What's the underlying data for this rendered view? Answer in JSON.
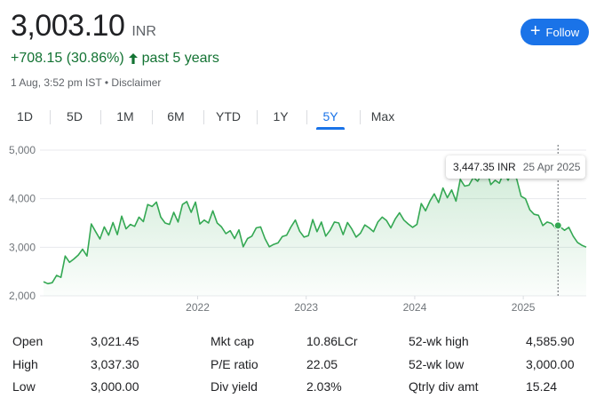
{
  "header": {
    "price": "3,003.10",
    "currency": "INR",
    "follow_label": "Follow",
    "change": "+708.15 (30.86%)",
    "period": "past 5 years",
    "timestamp": "1 Aug, 3:52 pm IST",
    "separator": "•",
    "disclaimer": "Disclaimer"
  },
  "tabs": [
    {
      "label": "1D"
    },
    {
      "label": "5D"
    },
    {
      "label": "1M"
    },
    {
      "label": "6M"
    },
    {
      "label": "YTD"
    },
    {
      "label": "1Y"
    },
    {
      "label": "5Y",
      "active": true
    },
    {
      "label": "Max"
    }
  ],
  "tooltip": {
    "value": "3,447.35 INR",
    "date": "25 Apr 2025"
  },
  "colors": {
    "accent": "#1a73e8",
    "positive": "#137333",
    "line": "#34a853"
  },
  "chart_data": {
    "type": "line",
    "y_ticks": [
      "5,000",
      "4,000",
      "3,000",
      "2,000"
    ],
    "x_ticks": [
      "2022",
      "2023",
      "2024",
      "2025"
    ],
    "ylim": [
      2000,
      5000
    ],
    "xlim": [
      2020.58,
      2025.58
    ],
    "grid": true,
    "x": [
      2020.58,
      2020.62,
      2020.66,
      2020.7,
      2020.74,
      2020.78,
      2020.82,
      2020.86,
      2020.9,
      2020.94,
      2020.98,
      2021.02,
      2021.06,
      2021.1,
      2021.14,
      2021.18,
      2021.22,
      2021.26,
      2021.3,
      2021.34,
      2021.38,
      2021.42,
      2021.46,
      2021.5,
      2021.54,
      2021.58,
      2021.62,
      2021.66,
      2021.7,
      2021.74,
      2021.78,
      2021.82,
      2021.86,
      2021.9,
      2021.94,
      2021.98,
      2022.02,
      2022.06,
      2022.1,
      2022.14,
      2022.18,
      2022.22,
      2022.26,
      2022.3,
      2022.34,
      2022.38,
      2022.42,
      2022.46,
      2022.5,
      2022.54,
      2022.58,
      2022.62,
      2022.66,
      2022.7,
      2022.74,
      2022.78,
      2022.82,
      2022.86,
      2022.9,
      2022.94,
      2022.98,
      2023.02,
      2023.06,
      2023.1,
      2023.14,
      2023.18,
      2023.22,
      2023.26,
      2023.3,
      2023.34,
      2023.38,
      2023.42,
      2023.46,
      2023.5,
      2023.54,
      2023.58,
      2023.62,
      2023.66,
      2023.7,
      2023.74,
      2023.78,
      2023.82,
      2023.86,
      2023.9,
      2023.94,
      2023.98,
      2024.02,
      2024.06,
      2024.1,
      2024.14,
      2024.18,
      2024.22,
      2024.26,
      2024.3,
      2024.34,
      2024.38,
      2024.42,
      2024.46,
      2024.5,
      2024.54,
      2024.58,
      2024.62,
      2024.66,
      2024.7,
      2024.74,
      2024.78,
      2024.82,
      2024.86,
      2024.9,
      2024.94,
      2024.98,
      2025.02,
      2025.06,
      2025.1,
      2025.14,
      2025.18,
      2025.22,
      2025.26,
      2025.3,
      2025.34,
      2025.38,
      2025.42,
      2025.46,
      2025.5,
      2025.54,
      2025.58
    ],
    "series": [
      {
        "values": [
          2290,
          2250,
          2270,
          2420,
          2380,
          2820,
          2690,
          2760,
          2840,
          2960,
          2820,
          3480,
          3320,
          3170,
          3420,
          3250,
          3510,
          3260,
          3640,
          3380,
          3470,
          3430,
          3620,
          3530,
          3880,
          3840,
          3930,
          3620,
          3500,
          3470,
          3720,
          3520,
          3880,
          3940,
          3720,
          3930,
          3480,
          3560,
          3500,
          3750,
          3500,
          3420,
          3280,
          3340,
          3180,
          3360,
          3010,
          3180,
          3230,
          3400,
          3420,
          3180,
          3010,
          3060,
          3090,
          3220,
          3250,
          3420,
          3560,
          3330,
          3210,
          3240,
          3570,
          3320,
          3520,
          3230,
          3350,
          3520,
          3500,
          3260,
          3510,
          3380,
          3210,
          3290,
          3460,
          3400,
          3320,
          3520,
          3620,
          3550,
          3400,
          3580,
          3710,
          3560,
          3480,
          3410,
          3470,
          3900,
          3750,
          3950,
          4100,
          3920,
          4220,
          4020,
          4180,
          3950,
          4400,
          4260,
          4280,
          4440,
          4360,
          4530,
          4620,
          4290,
          4380,
          4320,
          4540,
          4380,
          4580,
          4400,
          4050,
          4000,
          3770,
          3680,
          3660,
          3447,
          3520,
          3490,
          3390,
          3420,
          3350,
          3410,
          3230,
          3100,
          3040,
          3003
        ]
      }
    ],
    "highlight": {
      "x": 2025.32,
      "y": 3447.35,
      "label_value": "3,447.35 INR",
      "label_date": "25 Apr 2025"
    }
  },
  "stats": [
    [
      {
        "label": "Open",
        "value": "3,021.45"
      },
      {
        "label": "Mkt cap",
        "value": "10.86LCr"
      },
      {
        "label": "52-wk high",
        "value": "4,585.90"
      }
    ],
    [
      {
        "label": "High",
        "value": "3,037.30"
      },
      {
        "label": "P/E ratio",
        "value": "22.05"
      },
      {
        "label": "52-wk low",
        "value": "3,000.00"
      }
    ],
    [
      {
        "label": "Low",
        "value": "3,000.00"
      },
      {
        "label": "Div yield",
        "value": "2.03%"
      },
      {
        "label": "Qtrly div amt",
        "value": "15.24"
      }
    ]
  ]
}
